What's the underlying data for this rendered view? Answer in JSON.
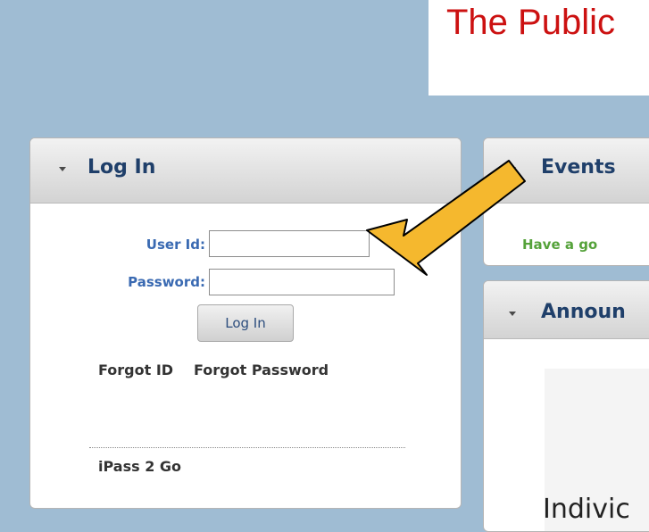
{
  "header": {
    "title": "The Public"
  },
  "login": {
    "title": "Log In",
    "user_id_label": "User Id:",
    "user_id_value": "",
    "password_label": "Password:",
    "password_value": "",
    "button_label": "Log In",
    "forgot_id": "Forgot ID",
    "forgot_password": "Forgot Password",
    "ipass_link": "iPass 2 Go"
  },
  "events": {
    "title": "Events",
    "message": "Have a go"
  },
  "announcements": {
    "title": "Announ",
    "text": "Indivic"
  },
  "annotation": {
    "arrow_color": "#f5b82e",
    "arrow_outline": "#000000"
  }
}
